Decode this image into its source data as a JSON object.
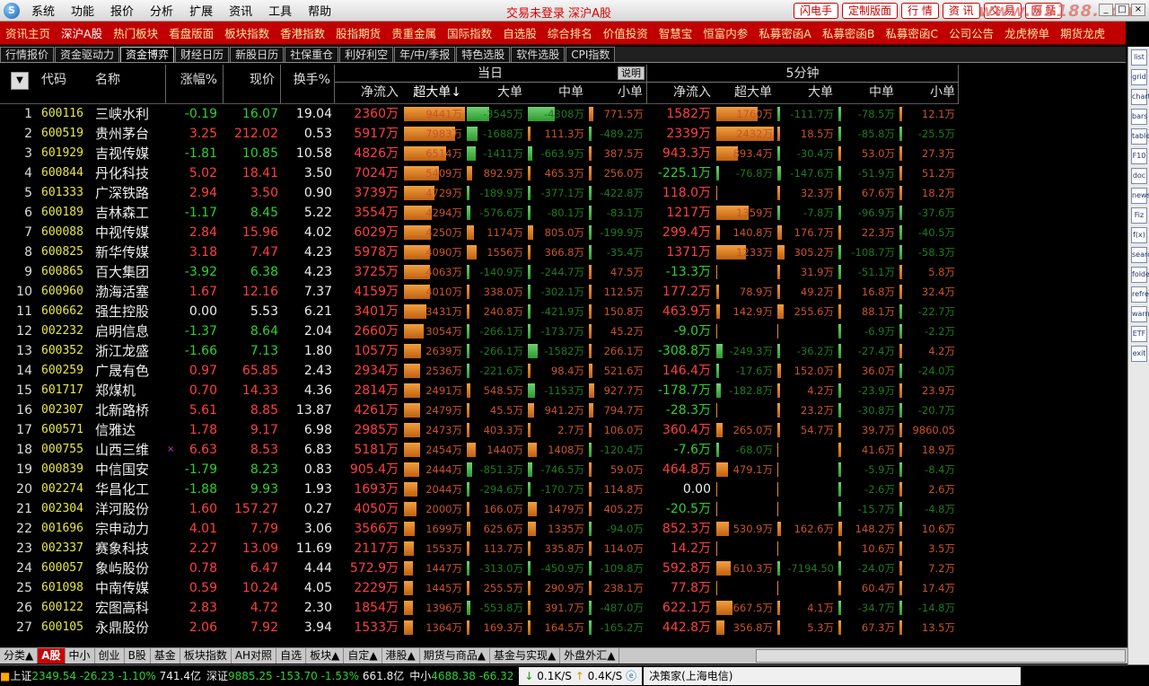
{
  "menu": {
    "logo": "S",
    "items": [
      "系统",
      "功能",
      "报价",
      "分析",
      "扩展",
      "资讯",
      "工具",
      "帮助"
    ],
    "center": "交易未登录 深沪A股",
    "buttons": [
      "闪电手",
      "定制版面",
      "行 情",
      "资 讯",
      "交 易",
      "网 站"
    ],
    "watermark": "www.55188.com"
  },
  "redbar": [
    "资讯主页",
    "深沪A股",
    "热门板块",
    "看盘版面",
    "板块指数",
    "香港指数",
    "股指期货",
    "贵重金属",
    "国际指数",
    "自选股",
    "综合排名",
    "价值投资",
    "智慧宝",
    "恒富内参",
    "私募密函A",
    "私募密函B",
    "私募密函C",
    "公司公告",
    "龙虎榜单",
    "期货龙虎"
  ],
  "tabs": [
    "行情报价",
    "资金驱动力",
    "资金博弈",
    "财经日历",
    "新股日历",
    "社保重仓",
    "利好利空",
    "年/中/季报",
    "特色选股",
    "软件选股",
    "CPI指数"
  ],
  "active_tab": "资金博弈",
  "right_icons": [
    "list",
    "grid",
    "chart",
    "bars",
    "table",
    "F10",
    "doc",
    "news",
    "Fiz",
    "f(x)",
    "search",
    "folder",
    "refresh",
    "warn",
    "ETF",
    "exit"
  ],
  "headers": {
    "group_today": "当日",
    "group_5min": "5分钟",
    "shuoming": "说明",
    "sel": "▼",
    "code": "代码",
    "name": "名称",
    "pct": "涨幅%",
    "price": "现价",
    "turnover": "换手%",
    "net": "净流入",
    "xl": "超大单↓",
    "l": "大单",
    "m": "中单",
    "s": "小单",
    "net5": "净流入",
    "xl5": "超大单",
    "l5": "大单",
    "m5": "中单",
    "s5": "小单"
  },
  "rows": [
    {
      "n": "1",
      "code": "600116",
      "name": "三峡水利",
      "pct": "-0.19",
      "price": "16.07",
      "to": "19.04",
      "net": "2360万",
      "xl": "9441万",
      "l": "-3545万",
      "m": "-4308万",
      "s": "771.5万",
      "net5": "1582万",
      "xl5": "1760万",
      "l5": "-111.7万",
      "m5": "-78.5万",
      "s5": "12.1万"
    },
    {
      "n": "2",
      "code": "600519",
      "name": "贵州茅台",
      "pct": "3.25",
      "price": "212.02",
      "to": "0.53",
      "net": "5917万",
      "xl": "7983万",
      "l": "-1688万",
      "m": "111.3万",
      "s": "-489.2万",
      "net5": "2339万",
      "xl5": "2432万",
      "l5": "18.5万",
      "m5": "-85.8万",
      "s5": "-25.5万"
    },
    {
      "n": "3",
      "code": "601929",
      "name": "吉视传媒",
      "pct": "-1.81",
      "price": "10.85",
      "to": "10.58",
      "net": "4826万",
      "xl": "6514万",
      "l": "-1411万",
      "m": "-663.9万",
      "s": "387.5万",
      "net5": "943.3万",
      "xl5": "893.4万",
      "l5": "-30.4万",
      "m5": "53.0万",
      "s5": "27.3万"
    },
    {
      "n": "4",
      "code": "600844",
      "name": "丹化科技",
      "pct": "5.02",
      "price": "18.41",
      "to": "3.50",
      "net": "7024万",
      "xl": "5409万",
      "l": "892.9万",
      "m": "465.3万",
      "s": "256.0万",
      "net5": "-225.1万",
      "xl5": "-76.8万",
      "l5": "-147.6万",
      "m5": "-51.9万",
      "s5": "51.2万"
    },
    {
      "n": "5",
      "code": "601333",
      "name": "广深铁路",
      "pct": "2.94",
      "price": "3.50",
      "to": "0.90",
      "net": "3739万",
      "xl": "4729万",
      "l": "-189.9万",
      "m": "-377.1万",
      "s": "-422.8万",
      "net5": "118.0万",
      "xl5": "",
      "l5": "32.3万",
      "m5": "67.6万",
      "s5": "18.2万"
    },
    {
      "n": "6",
      "code": "600189",
      "name": "吉林森工",
      "pct": "-1.17",
      "price": "8.45",
      "to": "5.22",
      "net": "3554万",
      "xl": "4294万",
      "l": "-576.6万",
      "m": "-80.1万",
      "s": "-83.1万",
      "net5": "1217万",
      "xl5": "1359万",
      "l5": "-7.8万",
      "m5": "-96.9万",
      "s5": "-37.6万"
    },
    {
      "n": "7",
      "code": "600088",
      "name": "中视传媒",
      "pct": "2.84",
      "price": "15.96",
      "to": "4.02",
      "net": "6029万",
      "xl": "4250万",
      "l": "1174万",
      "m": "805.0万",
      "s": "-199.9万",
      "net5": "299.4万",
      "xl5": "140.8万",
      "l5": "176.7万",
      "m5": "22.3万",
      "s5": "-40.5万"
    },
    {
      "n": "8",
      "code": "600825",
      "name": "新华传媒",
      "pct": "3.18",
      "price": "7.47",
      "to": "4.23",
      "net": "5978万",
      "xl": "4090万",
      "l": "1556万",
      "m": "366.8万",
      "s": "-35.4万",
      "net5": "1371万",
      "xl5": "1233万",
      "l5": "305.2万",
      "m5": "-108.7万",
      "s5": "-58.3万"
    },
    {
      "n": "9",
      "code": "600865",
      "name": "百大集团",
      "pct": "-3.92",
      "price": "6.38",
      "to": "4.23",
      "net": "3725万",
      "xl": "4063万",
      "l": "-140.9万",
      "m": "-244.7万",
      "s": "47.5万",
      "net5": "-13.3万",
      "xl5": "",
      "l5": "31.9万",
      "m5": "-51.1万",
      "s5": "5.8万"
    },
    {
      "n": "10",
      "code": "600960",
      "name": "渤海活塞",
      "pct": "1.67",
      "price": "12.16",
      "to": "7.37",
      "net": "4159万",
      "xl": "4010万",
      "l": "338.0万",
      "m": "-302.1万",
      "s": "112.5万",
      "net5": "177.2万",
      "xl5": "78.9万",
      "l5": "49.2万",
      "m5": "16.8万",
      "s5": "32.4万"
    },
    {
      "n": "11",
      "code": "600662",
      "name": "强生控股",
      "pct": "0.00",
      "price": "5.53",
      "to": "6.21",
      "net": "3401万",
      "xl": "3431万",
      "l": "240.8万",
      "m": "-421.9万",
      "s": "150.8万",
      "net5": "463.9万",
      "xl5": "142.9万",
      "l5": "255.6万",
      "m5": "88.1万",
      "s5": "-22.7万"
    },
    {
      "n": "12",
      "code": "002232",
      "name": "启明信息",
      "pct": "-1.37",
      "price": "8.64",
      "to": "2.04",
      "net": "2660万",
      "xl": "3054万",
      "l": "-266.1万",
      "m": "-173.7万",
      "s": "45.2万",
      "net5": "-9.0万",
      "xl5": "",
      "l5": "",
      "m5": "-6.9万",
      "s5": "-2.2万"
    },
    {
      "n": "13",
      "code": "600352",
      "name": "浙江龙盛",
      "pct": "-1.66",
      "price": "7.13",
      "to": "1.80",
      "net": "1057万",
      "xl": "2639万",
      "l": "-266.1万",
      "m": "-1582万",
      "s": "266.1万",
      "net5": "-308.8万",
      "xl5": "-249.3万",
      "l5": "-36.2万",
      "m5": "-27.4万",
      "s5": "4.2万"
    },
    {
      "n": "14",
      "code": "600259",
      "name": "广晟有色",
      "pct": "0.97",
      "price": "65.85",
      "to": "2.43",
      "net": "2934万",
      "xl": "2536万",
      "l": "-221.6万",
      "m": "98.4万",
      "s": "521.6万",
      "net5": "146.4万",
      "xl5": "-17.6万",
      "l5": "152.0万",
      "m5": "36.0万",
      "s5": "-24.0万"
    },
    {
      "n": "15",
      "code": "601717",
      "name": "郑煤机",
      "pct": "0.70",
      "price": "14.33",
      "to": "4.36",
      "net": "2814万",
      "xl": "2491万",
      "l": "548.5万",
      "m": "-1153万",
      "s": "927.7万",
      "net5": "-178.7万",
      "xl5": "-182.8万",
      "l5": "4.2万",
      "m5": "-23.9万",
      "s5": "23.9万"
    },
    {
      "n": "16",
      "code": "002307",
      "name": "北新路桥",
      "pct": "5.61",
      "price": "8.85",
      "to": "13.87",
      "net": "4261万",
      "xl": "2479万",
      "l": "45.5万",
      "m": "941.2万",
      "s": "794.7万",
      "net5": "-28.3万",
      "xl5": "",
      "l5": "23.2万",
      "m5": "-30.8万",
      "s5": "-20.7万"
    },
    {
      "n": "17",
      "code": "600571",
      "name": "信雅达",
      "pct": "1.78",
      "price": "9.17",
      "to": "6.98",
      "net": "2985万",
      "xl": "2473万",
      "l": "403.3万",
      "m": "2.7万",
      "s": "106.0万",
      "net5": "360.4万",
      "xl5": "265.0万",
      "l5": "54.7万",
      "m5": "39.7万",
      "s5": "9860.05"
    },
    {
      "n": "18",
      "code": "000755",
      "name": "山西三维",
      "pct": "6.63",
      "price": "8.53",
      "to": "6.83",
      "net": "5181万",
      "xl": "2454万",
      "l": "1440万",
      "m": "1408万",
      "s": "-120.4万",
      "net5": "-7.6万",
      "xl5": "-68.0万",
      "l5": "",
      "m5": "41.6万",
      "s5": "18.9万",
      "mark": "×"
    },
    {
      "n": "19",
      "code": "000839",
      "name": "中信国安",
      "pct": "-1.79",
      "price": "8.23",
      "to": "0.83",
      "net": "905.4万",
      "xl": "2444万",
      "l": "-851.3万",
      "m": "-746.5万",
      "s": "59.0万",
      "net5": "464.8万",
      "xl5": "479.1万",
      "l5": "",
      "m5": "-5.9万",
      "s5": "-8.4万"
    },
    {
      "n": "20",
      "code": "002274",
      "name": "华昌化工",
      "pct": "-1.88",
      "price": "9.93",
      "to": "1.93",
      "net": "1693万",
      "xl": "2044万",
      "l": "-294.6万",
      "m": "-170.7万",
      "s": "114.8万",
      "net5": "0.00",
      "xl5": "",
      "l5": "",
      "m5": "-2.6万",
      "s5": "2.6万"
    },
    {
      "n": "21",
      "code": "002304",
      "name": "洋河股份",
      "pct": "1.60",
      "price": "157.27",
      "to": "0.27",
      "net": "4050万",
      "xl": "2000万",
      "l": "166.0万",
      "m": "1479万",
      "s": "405.2万",
      "net5": "-20.5万",
      "xl5": "",
      "l5": "",
      "m5": "-15.7万",
      "s5": "-4.8万"
    },
    {
      "n": "22",
      "code": "001696",
      "name": "宗申动力",
      "pct": "4.01",
      "price": "7.79",
      "to": "3.06",
      "net": "3566万",
      "xl": "1699万",
      "l": "625.6万",
      "m": "1335万",
      "s": "-94.0万",
      "net5": "852.3万",
      "xl5": "530.9万",
      "l5": "162.6万",
      "m5": "148.2万",
      "s5": "10.6万"
    },
    {
      "n": "23",
      "code": "002337",
      "name": "赛象科技",
      "pct": "2.27",
      "price": "13.09",
      "to": "11.69",
      "net": "2117万",
      "xl": "1553万",
      "l": "113.7万",
      "m": "335.8万",
      "s": "114.0万",
      "net5": "14.2万",
      "xl5": "",
      "l5": "",
      "m5": "10.6万",
      "s5": "3.5万"
    },
    {
      "n": "24",
      "code": "600057",
      "name": "象屿股份",
      "pct": "0.78",
      "price": "6.47",
      "to": "4.44",
      "net": "572.9万",
      "xl": "1447万",
      "l": "-313.0万",
      "m": "-450.9万",
      "s": "-109.8万",
      "net5": "592.8万",
      "xl5": "610.3万",
      "l5": "-7194.50",
      "m5": "-24.0万",
      "s5": "7.2万"
    },
    {
      "n": "25",
      "code": "601098",
      "name": "中南传媒",
      "pct": "0.59",
      "price": "10.24",
      "to": "4.05",
      "net": "2229万",
      "xl": "1445万",
      "l": "255.5万",
      "m": "290.9万",
      "s": "238.1万",
      "net5": "77.8万",
      "xl5": "",
      "l5": "",
      "m5": "60.4万",
      "s5": "17.4万"
    },
    {
      "n": "26",
      "code": "600122",
      "name": "宏图高科",
      "pct": "2.83",
      "price": "4.72",
      "to": "2.30",
      "net": "1854万",
      "xl": "1396万",
      "l": "-553.8万",
      "m": "391.7万",
      "s": "-487.0万",
      "net5": "622.1万",
      "xl5": "667.5万",
      "l5": "4.1万",
      "m5": "-34.7万",
      "s5": "-14.8万"
    },
    {
      "n": "27",
      "code": "600105",
      "name": "永鼎股份",
      "pct": "2.06",
      "price": "7.92",
      "to": "3.94",
      "net": "1533万",
      "xl": "1364万",
      "l": "169.3万",
      "m": "164.5万",
      "s": "-165.2万",
      "net5": "442.8万",
      "xl5": "356.8万",
      "l5": "5.3万",
      "m5": "67.3万",
      "s5": "13.5万"
    }
  ],
  "bottom_tabs": [
    "分类▲",
    "A股",
    "中小",
    "创业",
    "B股",
    "基金",
    "板块指数",
    "AH对照",
    "自选",
    "板块▲",
    "自定▲",
    "港股▲",
    "期货与商品▲",
    "基金与实现▲",
    "外盘外汇▲"
  ],
  "active_bottom": "A股",
  "status": {
    "sh_label": "上证",
    "sh": "2349.54",
    "sh_chg": "-26.23",
    "sh_pct": "-1.10%",
    "sh_amt": "741.4亿",
    "sz_label": "深证",
    "sz": "9885.25",
    "sz_chg": "-153.70",
    "sz_pct": "-1.53%",
    "sz_amt": "661.8亿",
    "zx_label": "中小",
    "zx": "4688.38",
    "zx_chg": "-66.32",
    "down": "0.1K/S",
    "up": "0.4K/S",
    "broker": "决策家(上海电信)"
  },
  "colors": {
    "up": "#ff4040",
    "down": "#30d030",
    "code": "#e8e840",
    "bar_in": "#e08a30",
    "bar_out": "#46b946",
    "redbar": "#c00000"
  }
}
